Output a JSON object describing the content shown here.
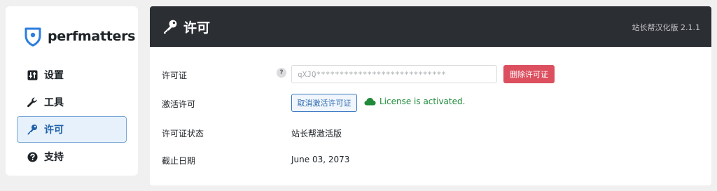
{
  "brand": {
    "name": "perfmatters"
  },
  "nav": {
    "items": [
      {
        "label": "设置",
        "icon": "settings-sliders-icon",
        "active": false
      },
      {
        "label": "工具",
        "icon": "wrench-icon",
        "active": false
      },
      {
        "label": "许可",
        "icon": "key-icon",
        "active": true
      },
      {
        "label": "支持",
        "icon": "question-circle-icon",
        "active": false
      }
    ]
  },
  "header": {
    "title": "许可",
    "version": "站长帮汉化版 2.1.1"
  },
  "license": {
    "key_label": "许可证",
    "key_value": "qXJQ****************************",
    "help_symbol": "?",
    "remove_button": "删除许可证",
    "activate_label": "激活许可",
    "deactivate_button": "取消激活许可证",
    "status_text": "License is activated.",
    "status_label": "许可证状态",
    "status_value": "站长帮激活版",
    "expiry_label": "截止日期",
    "expiry_value": "June 03, 2073"
  },
  "colors": {
    "header_bg": "#2b2e33",
    "active_nav_bg": "#e7f1fb",
    "danger": "#dc4f5f",
    "success": "#1f8a3a",
    "link_blue": "#2f6bb1"
  }
}
